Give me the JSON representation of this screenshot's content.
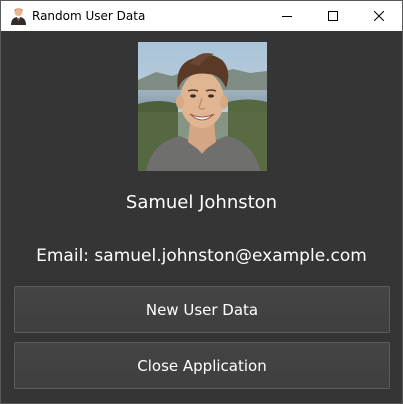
{
  "window": {
    "title": "Random User Data",
    "icon": "user-avatar-icon",
    "controls": {
      "minimize": "minimize-icon",
      "maximize": "maximize-icon",
      "close": "close-icon"
    }
  },
  "user": {
    "name": "Samuel Johnston",
    "email_text": "Email: samuel.johnston@example.com"
  },
  "actions": {
    "new_user_label": "New User Data",
    "close_label": "Close Application"
  },
  "colors": {
    "background": "#353535",
    "button_bg": "#424242",
    "button_border": "#5c5c5c",
    "text": "#ffffff"
  }
}
